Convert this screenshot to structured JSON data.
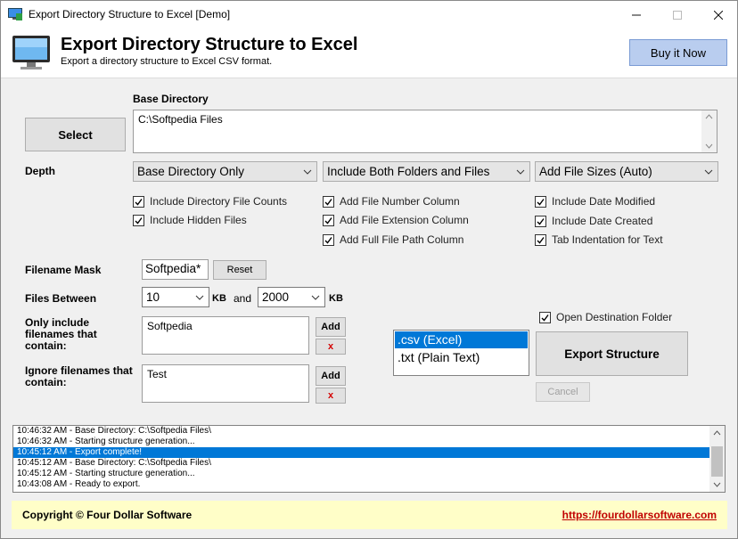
{
  "window": {
    "title": "Export Directory Structure to Excel [Demo]"
  },
  "header": {
    "title": "Export Directory Structure to Excel",
    "subtitle": "Export a directory structure to Excel CSV format.",
    "buy_label": "Buy it Now"
  },
  "base_directory": {
    "label": "Base Directory",
    "select_label": "Select",
    "value": "C:\\Softpedia Files"
  },
  "depth": {
    "label": "Depth",
    "depth_value": "Base Directory Only",
    "include_value": "Include Both Folders and Files",
    "sizes_value": "Add File Sizes (Auto)"
  },
  "options": {
    "col1": [
      {
        "label": "Include Directory File Counts",
        "checked": true
      },
      {
        "label": "Include Hidden Files",
        "checked": true
      }
    ],
    "col2": [
      {
        "label": "Add File Number Column",
        "checked": true
      },
      {
        "label": "Add File Extension Column",
        "checked": true
      },
      {
        "label": "Add Full File Path Column",
        "checked": true
      }
    ],
    "col3": [
      {
        "label": "Include Date Modified",
        "checked": true
      },
      {
        "label": "Include Date Created",
        "checked": true
      },
      {
        "label": "Tab Indentation for Text",
        "checked": true
      }
    ]
  },
  "filename_mask": {
    "label": "Filename Mask",
    "value": "Softpedia*",
    "reset_label": "Reset"
  },
  "files_between": {
    "label": "Files Between",
    "min": "10",
    "min_unit": "KB",
    "and_label": "and",
    "max": "2000",
    "max_unit": "KB"
  },
  "only_include": {
    "label": "Only include filenames that contain:",
    "value": "Softpedia",
    "add_label": "Add",
    "remove_label": "x"
  },
  "ignore": {
    "label": "Ignore filenames that contain:",
    "value": "Test",
    "add_label": "Add",
    "remove_label": "x"
  },
  "format_list": {
    "items": [
      {
        "label": ".csv (Excel)",
        "selected": true
      },
      {
        "label": ".txt (Plain Text)",
        "selected": false
      }
    ]
  },
  "open_destination": {
    "label": "Open Destination Folder",
    "checked": true
  },
  "export_label": "Export Structure",
  "cancel_label": "Cancel",
  "log": [
    {
      "text": "10:46:32 AM - Base Directory: C:\\Softpedia Files\\",
      "selected": false
    },
    {
      "text": "10:46:32 AM - Starting structure generation...",
      "selected": false
    },
    {
      "text": "10:45:12 AM - Export complete!",
      "selected": true
    },
    {
      "text": "10:45:12 AM - Base Directory: C:\\Softpedia Files\\",
      "selected": false
    },
    {
      "text": "10:45:12 AM - Starting structure generation...",
      "selected": false
    },
    {
      "text": "10:43:08 AM - Ready to export.",
      "selected": false
    }
  ],
  "footer": {
    "copyright": "Copyright © Four Dollar Software",
    "link": "https://fourdollarsoftware.com"
  },
  "colors": {
    "accent": "#0078d7",
    "buy": "#b9cdef",
    "footer": "#fffec8",
    "link": "#c00000"
  }
}
